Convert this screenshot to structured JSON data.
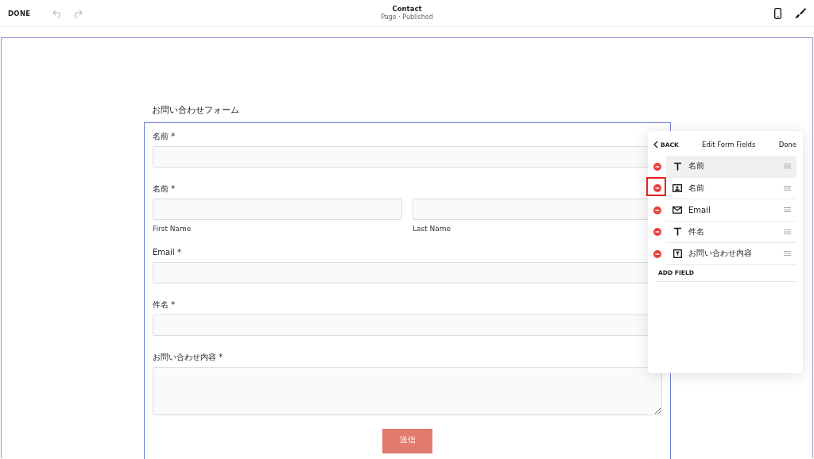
{
  "toolbar": {
    "done": "DONE",
    "title": "Contact",
    "subtitle": "Page · Published"
  },
  "form": {
    "heading": "お問い合わせフォーム",
    "submit": "送信",
    "fields": [
      {
        "kind": "single",
        "label": "名前 *"
      },
      {
        "kind": "name",
        "label": "名前 *",
        "sublabels": [
          "First Name",
          "Last Name"
        ]
      },
      {
        "kind": "single",
        "label": "Email *"
      },
      {
        "kind": "single",
        "label": "件名 *"
      },
      {
        "kind": "textarea",
        "label": "お問い合わせ内容 *"
      }
    ]
  },
  "panel": {
    "back": "BACK",
    "title": "Edit Form Fields",
    "done": "Done",
    "add": "ADD FIELD",
    "items": [
      {
        "kind": "text",
        "label": "名前",
        "selected": true,
        "highlighted": false
      },
      {
        "kind": "name",
        "label": "名前",
        "selected": false,
        "highlighted": true
      },
      {
        "kind": "email",
        "label": "Email",
        "selected": false,
        "highlighted": false
      },
      {
        "kind": "text",
        "label": "件名",
        "selected": false,
        "highlighted": false
      },
      {
        "kind": "textarea",
        "label": "お問い合わせ内容",
        "selected": false,
        "highlighted": false
      }
    ]
  }
}
